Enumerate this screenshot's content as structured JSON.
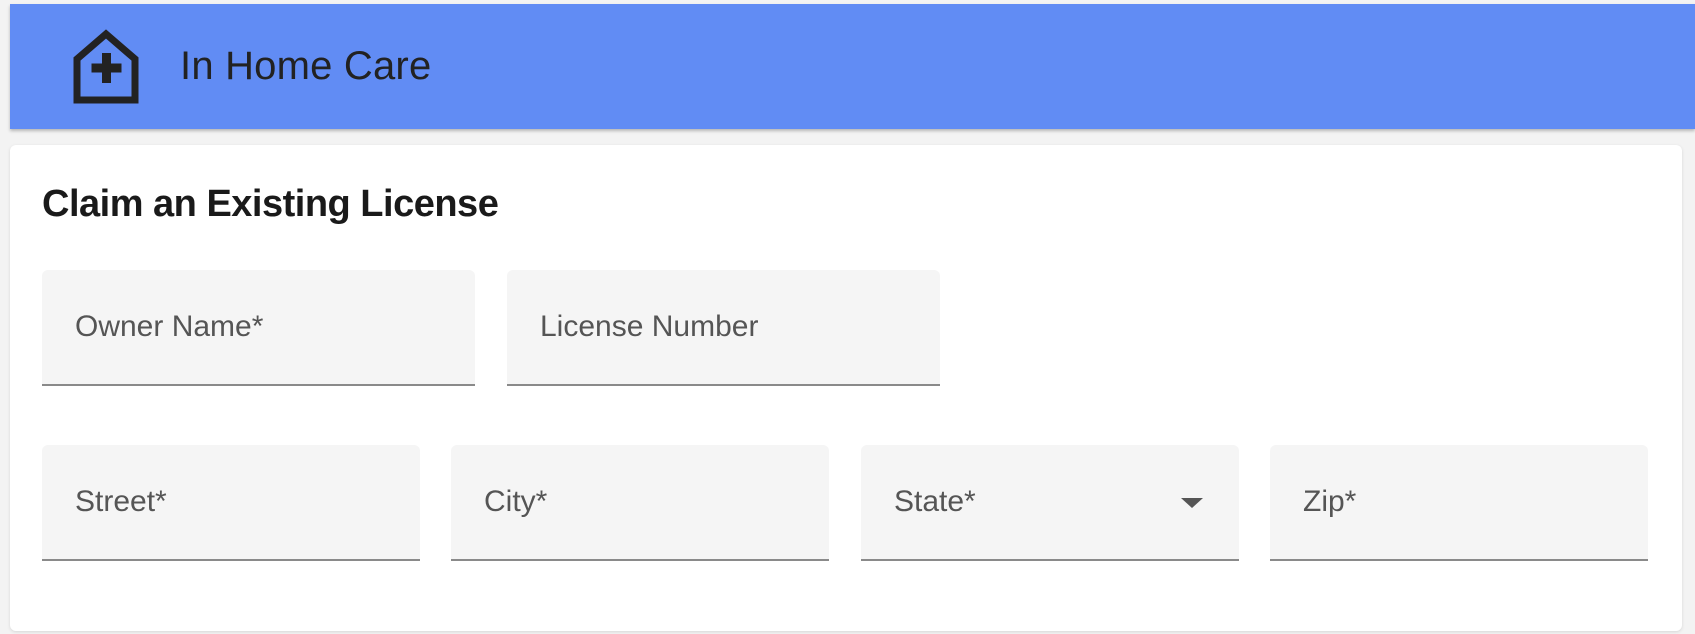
{
  "app_bar": {
    "title": "In Home Care",
    "logo_icon": "home-medical-icon",
    "background_color": "#618cf4"
  },
  "form": {
    "title": "Claim an Existing License",
    "fields": {
      "owner_name": {
        "label": "Owner Name*",
        "value": ""
      },
      "license_number": {
        "label": "License Number",
        "value": ""
      },
      "street": {
        "label": "Street*",
        "value": ""
      },
      "city": {
        "label": "City*",
        "value": ""
      },
      "state": {
        "label": "State*",
        "selected": "",
        "icon": "chevron-down-icon"
      },
      "zip": {
        "label": "Zip*",
        "value": ""
      }
    }
  }
}
